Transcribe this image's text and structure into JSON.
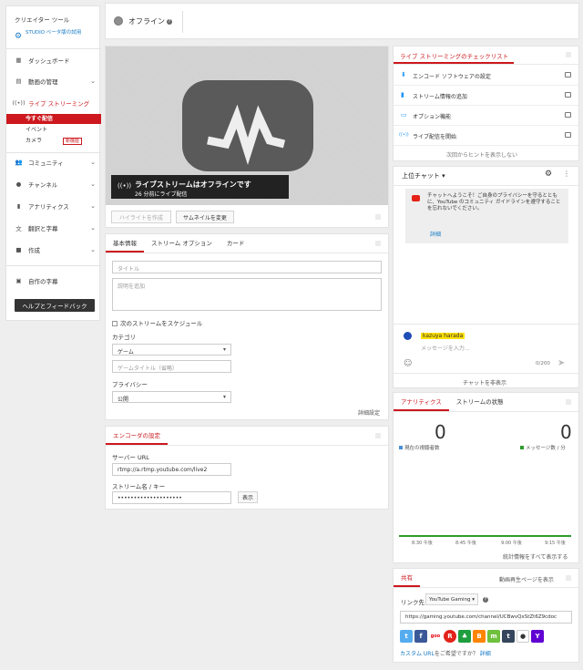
{
  "sidebar": {
    "section_title": "クリエイター ツール",
    "beta_label": "STUDIO ベータ版の試用",
    "items": [
      {
        "label": "ダッシュボード"
      },
      {
        "label": "動画の管理"
      },
      {
        "label": "ライブ ストリーミング"
      },
      {
        "label": "コミュニティ"
      },
      {
        "label": "チャンネル"
      },
      {
        "label": "アナリティクス"
      },
      {
        "label": "翻訳と字幕"
      },
      {
        "label": "作成"
      },
      {
        "label": "自作の字幕"
      }
    ],
    "live_sub": [
      {
        "label": "今すぐ配信"
      },
      {
        "label": "イベント"
      },
      {
        "label": "カメラ"
      }
    ],
    "new_badge": "新機能",
    "help_button": "ヘルプとフィードバック"
  },
  "topbar": {
    "status": "オフライン",
    "status_color": "#8e8e8e"
  },
  "player": {
    "offline_title": "ライブストリームはオフラインです",
    "offline_sub": "26 分前にライブ配信",
    "highlight_button": "ハイライトを作成",
    "thumbnail_button": "サムネイルを変更"
  },
  "info": {
    "tabs": [
      "基本情報",
      "ストリーム オプション",
      "カード"
    ],
    "title_placeholder": "タイトル",
    "desc_placeholder": "説明を追加",
    "schedule_label": "次のストリームをスケジュール",
    "category_label": "カテゴリ",
    "category_value": "ゲーム",
    "game_title_placeholder": "ゲームタイトル（省略）",
    "privacy_label": "プライバシー",
    "privacy_value": "公開",
    "advanced_link": "詳細設定"
  },
  "encoder": {
    "tab": "エンコーダの設定",
    "server_label": "サーバー URL",
    "server_value": "rtmp://a.rtmp.youtube.com/live2",
    "key_label": "ストリーム名 / キー",
    "key_value": "••••••••••••••••••••",
    "show_button": "表示"
  },
  "checklist": {
    "title": "ライブ ストリーミングのチェックリスト",
    "items": [
      {
        "label": "エンコード ソフトウェアの設定",
        "icon": "download-icon"
      },
      {
        "label": "ストリーム情報の追加",
        "icon": "chart-icon"
      },
      {
        "label": "オプション機能",
        "icon": "card-icon"
      },
      {
        "label": "ライブ配信を開始",
        "icon": "broadcast-icon"
      }
    ],
    "hide_link": "次回からヒントを表示しない"
  },
  "chat": {
    "title": "上位チャット",
    "welcome": "チャットへようこそ！ご自身のプライバシーを守るとともに、YouTube のコミュニティ ガイドラインを遵守することを忘れないでください。",
    "details_link": "詳細",
    "user_name": "kazuya harada",
    "input_placeholder": "メッセージを入力...",
    "counter": "0/200",
    "hide_chat": "チャットを非表示"
  },
  "analytics": {
    "tabs": [
      "アナリティクス",
      "ストリームの状態"
    ],
    "viewers_value": "0",
    "viewers_label": "現在の視聴者数",
    "messages_value": "0",
    "messages_label": "メッセージ数 / 分",
    "times": [
      "8:30 午後",
      "8:45 午後",
      "9:00 午後",
      "9:15 午後"
    ],
    "all_stats_link": "統計情報をすべて表示する",
    "viewers_color": "#4a90d9",
    "messages_color": "#2e9b2e"
  },
  "share": {
    "tab": "共有",
    "page_link": "動画再生ページを表示",
    "link_label": "リンク先",
    "link_select": "YouTube Gaming",
    "url": "https://gaming.youtube.com/channel/UCBwvQxStZt6Z9cdoc",
    "custom_url_link": "カスタム URL",
    "custom_url_text": "をご希望ですか？",
    "custom_url_details": "詳細"
  }
}
